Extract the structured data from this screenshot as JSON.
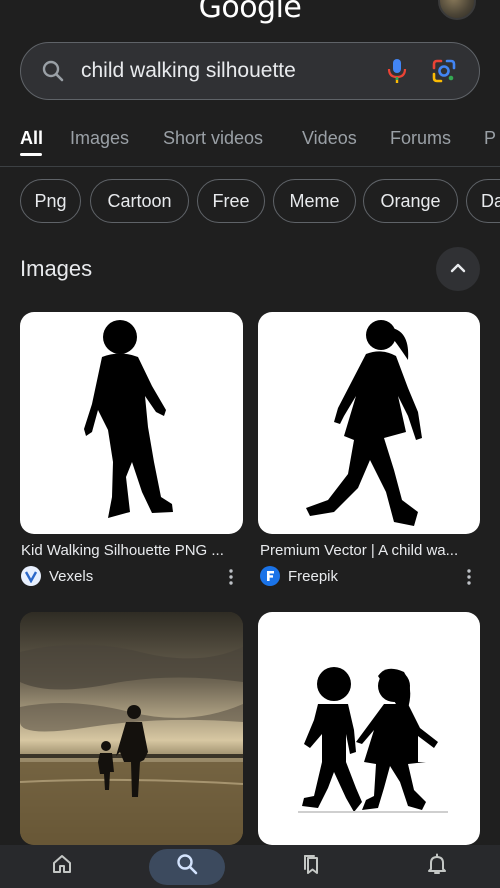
{
  "app": {
    "logo_text": "Google"
  },
  "search": {
    "query": "child walking silhouette"
  },
  "tabs": [
    {
      "label": "All",
      "active": true
    },
    {
      "label": "Images",
      "active": false
    },
    {
      "label": "Short videos",
      "active": false
    },
    {
      "label": "Videos",
      "active": false
    },
    {
      "label": "Forums",
      "active": false
    },
    {
      "label": "P",
      "active": false
    }
  ],
  "chips": [
    "Png",
    "Cartoon",
    "Free",
    "Meme",
    "Orange",
    "Da"
  ],
  "images_section": {
    "title": "Images"
  },
  "results": [
    {
      "title": "Kid Walking Silhouette PNG ...",
      "source": "Vexels",
      "source_icon": "vexels-logo-icon"
    },
    {
      "title": "Premium Vector | A child wa...",
      "source": "Freepik",
      "source_icon": "freepik-logo-icon"
    },
    {
      "title": "",
      "source": "",
      "source_icon": ""
    },
    {
      "title": "",
      "source": "",
      "source_icon": ""
    }
  ],
  "bottom_nav": [
    {
      "icon": "home-icon",
      "active": false
    },
    {
      "icon": "search-icon",
      "active": true
    },
    {
      "icon": "saved-icon",
      "active": false
    },
    {
      "icon": "notifications-icon",
      "active": false
    }
  ],
  "colors": {
    "background": "#1f1f1f",
    "search_bar": "#303134",
    "active_nav_pill": "#3c4a5e",
    "mic_blue": "#4285f4",
    "mic_red": "#ea4335"
  }
}
